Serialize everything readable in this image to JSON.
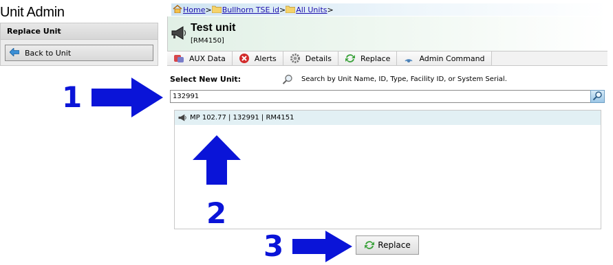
{
  "page_title": "Unit Admin",
  "left_panel": {
    "header": "Replace Unit",
    "back_button": "Back to Unit"
  },
  "breadcrumb": {
    "items": [
      "Home",
      "Bullhorn TSE id",
      "All Units"
    ],
    "separator": ">"
  },
  "unit": {
    "name": "Test unit",
    "code": "[RM4150]"
  },
  "tabs": [
    {
      "label": "AUX Data",
      "icon": "aux-data-icon"
    },
    {
      "label": "Alerts",
      "icon": "alert-x-icon"
    },
    {
      "label": "Details",
      "icon": "gear-icon"
    },
    {
      "label": "Replace",
      "icon": "replace-arrows-icon"
    },
    {
      "label": "Admin Command",
      "icon": "admin-command-icon"
    }
  ],
  "select": {
    "label": "Select New Unit:",
    "hint": "Search by Unit Name, ID, Type, Facility ID, or System Serial.",
    "search_value": "132991"
  },
  "results": [
    {
      "text": "MP 102.77 | 132991 | RM4151",
      "icon": "megaphone-icon"
    }
  ],
  "replace_button": "Replace",
  "annotations": [
    "1",
    "2",
    "3"
  ],
  "colors": {
    "annotation": "#0a14d8",
    "link": "#1a0dab",
    "result_highlight": "#e2f0f4"
  }
}
